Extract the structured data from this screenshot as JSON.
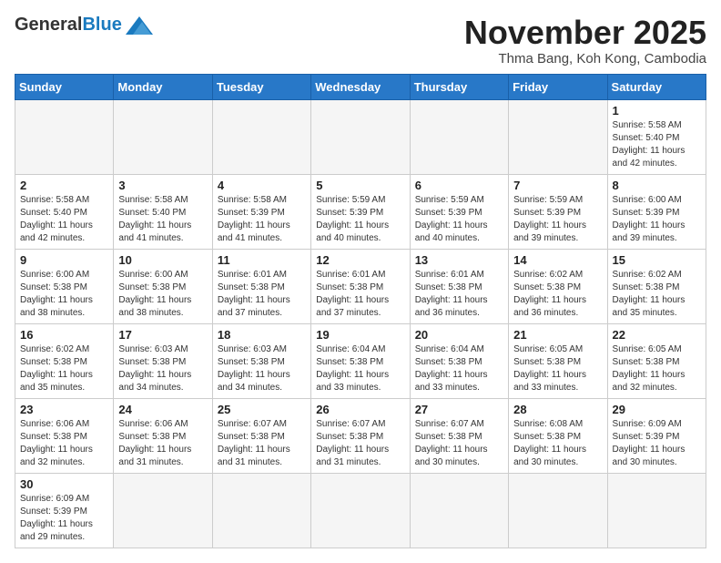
{
  "header": {
    "logo_line1": "General",
    "logo_line2": "Blue",
    "month_title": "November 2025",
    "location": "Thma Bang, Koh Kong, Cambodia"
  },
  "weekdays": [
    "Sunday",
    "Monday",
    "Tuesday",
    "Wednesday",
    "Thursday",
    "Friday",
    "Saturday"
  ],
  "days": [
    {
      "num": "",
      "empty": true
    },
    {
      "num": "",
      "empty": true
    },
    {
      "num": "",
      "empty": true
    },
    {
      "num": "",
      "empty": true
    },
    {
      "num": "",
      "empty": true
    },
    {
      "num": "",
      "empty": true
    },
    {
      "num": "1",
      "rise": "5:58 AM",
      "set": "5:40 PM",
      "hours": "11 hours and 42 minutes."
    },
    {
      "num": "2",
      "rise": "5:58 AM",
      "set": "5:40 PM",
      "hours": "11 hours and 42 minutes."
    },
    {
      "num": "3",
      "rise": "5:58 AM",
      "set": "5:40 PM",
      "hours": "11 hours and 41 minutes."
    },
    {
      "num": "4",
      "rise": "5:58 AM",
      "set": "5:39 PM",
      "hours": "11 hours and 41 minutes."
    },
    {
      "num": "5",
      "rise": "5:59 AM",
      "set": "5:39 PM",
      "hours": "11 hours and 40 minutes."
    },
    {
      "num": "6",
      "rise": "5:59 AM",
      "set": "5:39 PM",
      "hours": "11 hours and 40 minutes."
    },
    {
      "num": "7",
      "rise": "5:59 AM",
      "set": "5:39 PM",
      "hours": "11 hours and 39 minutes."
    },
    {
      "num": "8",
      "rise": "6:00 AM",
      "set": "5:39 PM",
      "hours": "11 hours and 39 minutes."
    },
    {
      "num": "9",
      "rise": "6:00 AM",
      "set": "5:38 PM",
      "hours": "11 hours and 38 minutes."
    },
    {
      "num": "10",
      "rise": "6:00 AM",
      "set": "5:38 PM",
      "hours": "11 hours and 38 minutes."
    },
    {
      "num": "11",
      "rise": "6:01 AM",
      "set": "5:38 PM",
      "hours": "11 hours and 37 minutes."
    },
    {
      "num": "12",
      "rise": "6:01 AM",
      "set": "5:38 PM",
      "hours": "11 hours and 37 minutes."
    },
    {
      "num": "13",
      "rise": "6:01 AM",
      "set": "5:38 PM",
      "hours": "11 hours and 36 minutes."
    },
    {
      "num": "14",
      "rise": "6:02 AM",
      "set": "5:38 PM",
      "hours": "11 hours and 36 minutes."
    },
    {
      "num": "15",
      "rise": "6:02 AM",
      "set": "5:38 PM",
      "hours": "11 hours and 35 minutes."
    },
    {
      "num": "16",
      "rise": "6:02 AM",
      "set": "5:38 PM",
      "hours": "11 hours and 35 minutes."
    },
    {
      "num": "17",
      "rise": "6:03 AM",
      "set": "5:38 PM",
      "hours": "11 hours and 34 minutes."
    },
    {
      "num": "18",
      "rise": "6:03 AM",
      "set": "5:38 PM",
      "hours": "11 hours and 34 minutes."
    },
    {
      "num": "19",
      "rise": "6:04 AM",
      "set": "5:38 PM",
      "hours": "11 hours and 33 minutes."
    },
    {
      "num": "20",
      "rise": "6:04 AM",
      "set": "5:38 PM",
      "hours": "11 hours and 33 minutes."
    },
    {
      "num": "21",
      "rise": "6:05 AM",
      "set": "5:38 PM",
      "hours": "11 hours and 33 minutes."
    },
    {
      "num": "22",
      "rise": "6:05 AM",
      "set": "5:38 PM",
      "hours": "11 hours and 32 minutes."
    },
    {
      "num": "23",
      "rise": "6:06 AM",
      "set": "5:38 PM",
      "hours": "11 hours and 32 minutes."
    },
    {
      "num": "24",
      "rise": "6:06 AM",
      "set": "5:38 PM",
      "hours": "11 hours and 31 minutes."
    },
    {
      "num": "25",
      "rise": "6:07 AM",
      "set": "5:38 PM",
      "hours": "11 hours and 31 minutes."
    },
    {
      "num": "26",
      "rise": "6:07 AM",
      "set": "5:38 PM",
      "hours": "11 hours and 31 minutes."
    },
    {
      "num": "27",
      "rise": "6:07 AM",
      "set": "5:38 PM",
      "hours": "11 hours and 30 minutes."
    },
    {
      "num": "28",
      "rise": "6:08 AM",
      "set": "5:38 PM",
      "hours": "11 hours and 30 minutes."
    },
    {
      "num": "29",
      "rise": "6:09 AM",
      "set": "5:39 PM",
      "hours": "11 hours and 30 minutes."
    },
    {
      "num": "30",
      "rise": "6:09 AM",
      "set": "5:39 PM",
      "hours": "11 hours and 29 minutes."
    },
    {
      "num": "",
      "empty": true
    },
    {
      "num": "",
      "empty": true
    },
    {
      "num": "",
      "empty": true
    },
    {
      "num": "",
      "empty": true
    },
    {
      "num": "",
      "empty": true
    },
    {
      "num": "",
      "empty": true
    }
  ],
  "labels": {
    "sunrise": "Sunrise:",
    "sunset": "Sunset:",
    "daylight": "Daylight:"
  }
}
